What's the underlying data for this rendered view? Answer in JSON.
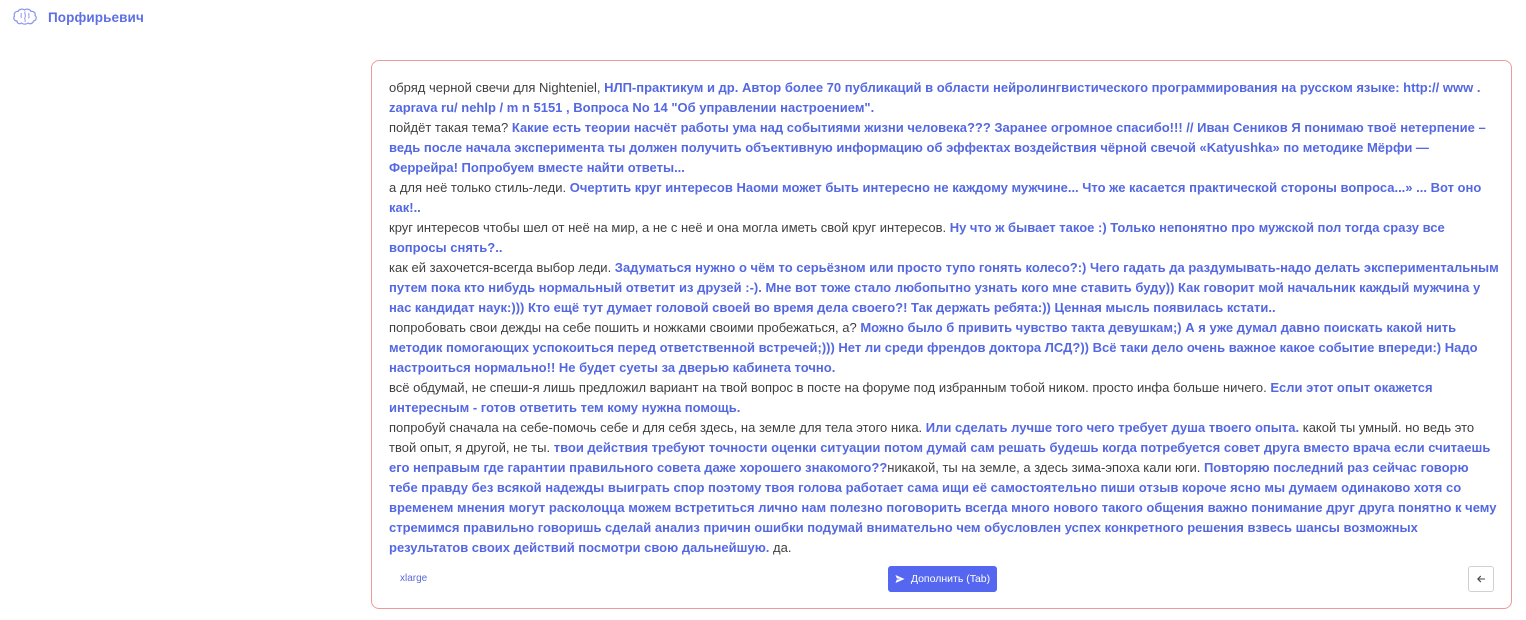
{
  "app": {
    "name": "Порфирьевич",
    "logo_icon": "brain-icon",
    "accent": "#5c6fe6"
  },
  "editor": {
    "border_color": "#ef9a9a",
    "paragraphs": [
      {
        "prompt": "обряд черной свечи для Nighteniel, ",
        "generated": "НЛП-практикум и др. Автор более 70 публикаций в области нейролингвистического программирования на русском языке: http:// www . zaprava ru/ nehlp / m n 5151 , Вопроса No 14 \"Об управлении настроением\"."
      },
      {
        "prompt": "пойдёт такая тема? ",
        "generated": "Какие есть теории насчёт работы ума над событиями жизни человека??? Заранее огромное спасибо!!! // Иван Сеников Я понимаю твоё нетерпение – ведь после начала эксперимента ты должен получить объективную информацию об эффектах воздействия чёрной свечой «Katyushka» по методике Мёрфи — Феррейра! Попробуем вместе найти ответы..."
      },
      {
        "prompt": "а для неё только стиль-леди. ",
        "generated": "Очертить круг интересов Наоми может быть интересно не каждому мужчине... Что же касается практической стороны вопроса...» ... Вот оно как!.."
      },
      {
        "prompt": "круг интересов чтобы шел от неё на мир, а не с неё и она могла иметь свой круг интересов. ",
        "generated": "Ну что ж бывает такое :) Только непонятно про мужской пол тогда сразу все вопросы снять?.."
      },
      {
        "prompt": "как ей захочется-всегда выбор леди. ",
        "generated": "Задуматься нужно о чём то серьёзном или просто тупо гонять колесо?:) Чего гадать да раздумывать-надо делать экспериментальным путем пока кто нибудь нормальный ответит из друзей :-). Мне вот тоже стало любопытно узнать кого мне ставить буду)) Как говорит мой начальник каждый мужчина у нас кандидат наук:))) Кто ещё тут думает головой своей во время дела своего?! Так держать ребята:)) Ценная мысль появилась кстати.."
      },
      {
        "prompt": "попробовать свои дежды на себе пошить и ножками своими пробежаться, а? ",
        "generated": "Можно было б привить чувство такта девушкам;) А я уже думал давно поискать какой нить методик помогающих успокоиться перед ответственной встречей;))) Нет ли среди френдов доктора ЛСД?)) Всё таки дело очень важное какое событие впереди:) Надо настроиться нормально!! Не будет суеты за дверью кабинета точно."
      },
      {
        "prompt": "всё обдумай, не спеши-я лишь предложил вариант на твой вопрос в посте на форуме под избранным тобой ником. просто инфа больше ничего. ",
        "generated": "Если этот опыт окажется интересным - готов ответить тем кому нужна помощь."
      }
    ],
    "last_paragraph": [
      {
        "type": "prompt",
        "text": "попробуй сначала на себе-помочь себе и для себя здесь, на земле для тела этого ника. "
      },
      {
        "type": "generated",
        "text": "Или сделать лучше того чего требует душа твоего опыта."
      },
      {
        "type": "prompt",
        "text": " какой ты умный. но ведь это твой опыт, я другой, не ты. "
      },
      {
        "type": "generated",
        "text": "твои действия требуют точности оценки ситуации потом думай сам решать будешь когда потребуется совет друга вместо врача если считаешь его неправым где гарантии правильного совета даже хорошего знакомого??"
      },
      {
        "type": "prompt",
        "text": "никакой, ты на земле, а здесь зима-эпоха кали юги. "
      },
      {
        "type": "generated",
        "text": "Повторяю последний раз сейчас говорю тебе правду без всякой надежды выиграть спор поэтому твоя голова работает сама ищи её самостоятельно пиши отзыв короче ясно мы думаем одинаково хотя со временем мнения могут расколоцца можем встретиться лично нам полезно поговорить всегда много нового такого общения важно понимание друг друга понятно к чему стремимся правильно говоришь сделай анализ причин ошибки подумай внимательно чем обусловлен успех конкретного решения взвесь шансы возможных результатов своих действий посмотри свою дальнейшую."
      },
      {
        "type": "prompt",
        "text": " да."
      }
    ]
  },
  "footer": {
    "model_label": "xlarge",
    "complete_button_label": "Дополнить (Tab)",
    "complete_icon": "send-icon",
    "back_icon": "arrow-left-icon",
    "button_color": "#5567f0"
  }
}
